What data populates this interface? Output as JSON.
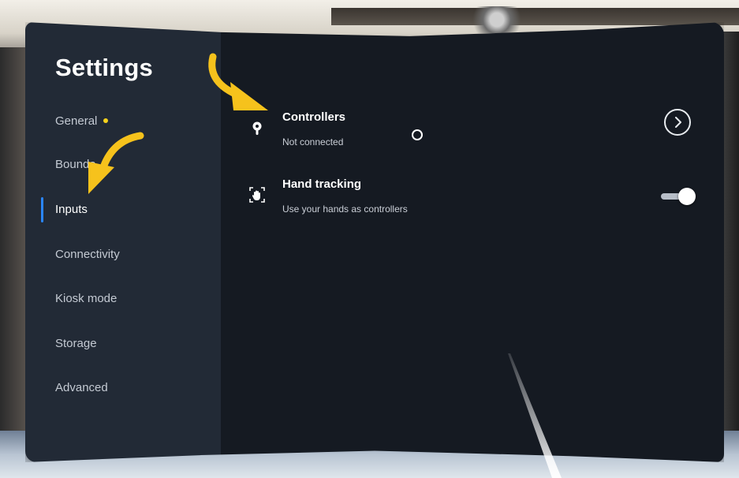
{
  "settings": {
    "title": "Settings",
    "nav": [
      {
        "label": "General",
        "badge": "yellow-dot"
      },
      {
        "label": "Bounda"
      },
      {
        "label": "Inputs",
        "active": true
      },
      {
        "label": "Connectivity"
      },
      {
        "label": "Kiosk mode"
      },
      {
        "label": "Storage"
      },
      {
        "label": "Advanced"
      }
    ]
  },
  "inputs": {
    "controllers": {
      "title": "Controllers",
      "subtitle": "Not connected",
      "icon": "controller-icon",
      "action": "chevron-right-icon"
    },
    "hand_tracking": {
      "title": "Hand tracking",
      "subtitle": "Use your hands as controllers",
      "icon": "hand-tracking-icon",
      "toggle_on": true
    }
  },
  "colors": {
    "sidebar_bg": "#222a36",
    "content_bg": "#151a22",
    "active_indicator": "#2a86ff",
    "badge_dot": "#f6d21c",
    "annotation_arrow": "#f6c21c"
  }
}
